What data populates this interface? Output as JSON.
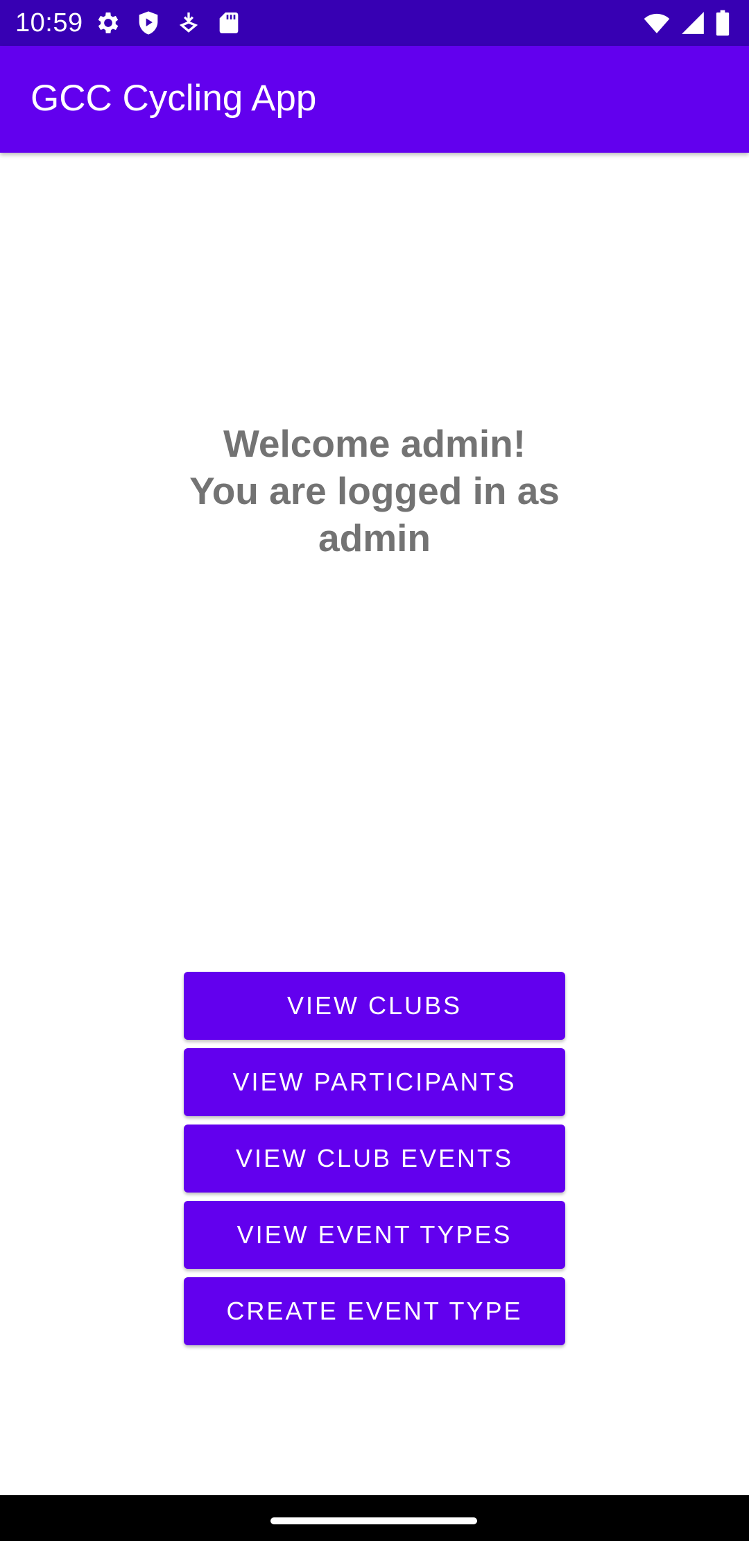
{
  "status_bar": {
    "time": "10:59",
    "left_icons": [
      "gear-icon",
      "shield-play-icon",
      "download-arrow-icon",
      "sd-card-icon"
    ],
    "right_icons": [
      "wifi-icon",
      "signal-icon",
      "battery-icon"
    ]
  },
  "app_bar": {
    "title": "GCC Cycling App"
  },
  "welcome": {
    "line1": "Welcome admin!",
    "line2": "You are logged in as",
    "line3": "admin"
  },
  "buttons": {
    "view_clubs": "VIEW CLUBS",
    "view_participants": "VIEW PARTICIPANTS",
    "view_club_events": "VIEW CLUB EVENTS",
    "view_event_types": "VIEW EVENT TYPES",
    "create_event_type": "CREATE EVENT TYPE"
  },
  "colors": {
    "status_bar": "#3700b3",
    "primary": "#6200ee",
    "welcome_text": "#737373",
    "button_text": "#ffffff"
  }
}
